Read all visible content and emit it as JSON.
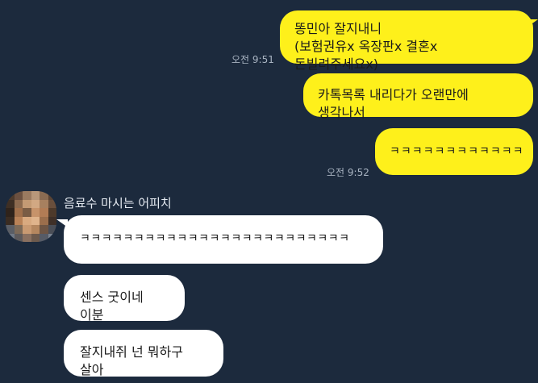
{
  "messages_out": [
    {
      "text": "똥민아 잘지내니\n(보험권유x 옥장판x 결혼x 돈빌려주세요x)"
    },
    {
      "text": "카톡목록 내리다가 오랜만에 생각나서"
    },
    {
      "text": "ㅋㅋㅋㅋㅋㅋㅋㅋㅋㅋㅋㅋ"
    }
  ],
  "timestamps": {
    "first": "오전 9:51",
    "second": "오전 9:52"
  },
  "sender": {
    "name": "음료수 마시는 어피치",
    "avatar_icon": "pixelated-profile-photo-icon"
  },
  "messages_in": [
    {
      "text": "ㅋㅋㅋㅋㅋㅋㅋㅋㅋㅋㅋㅋㅋㅋㅋㅋㅋㅋㅋㅋㅋㅋㅋㅋㅋ"
    },
    {
      "text": "센스 굿이네 이분"
    },
    {
      "text": "잘지내쥐 넌 뭐하구 살아"
    }
  ],
  "colors": {
    "background": "#1c2a3d",
    "my_bubble": "#fef01b",
    "their_bubble": "#ffffff",
    "timestamp": "#a9b4c2"
  }
}
